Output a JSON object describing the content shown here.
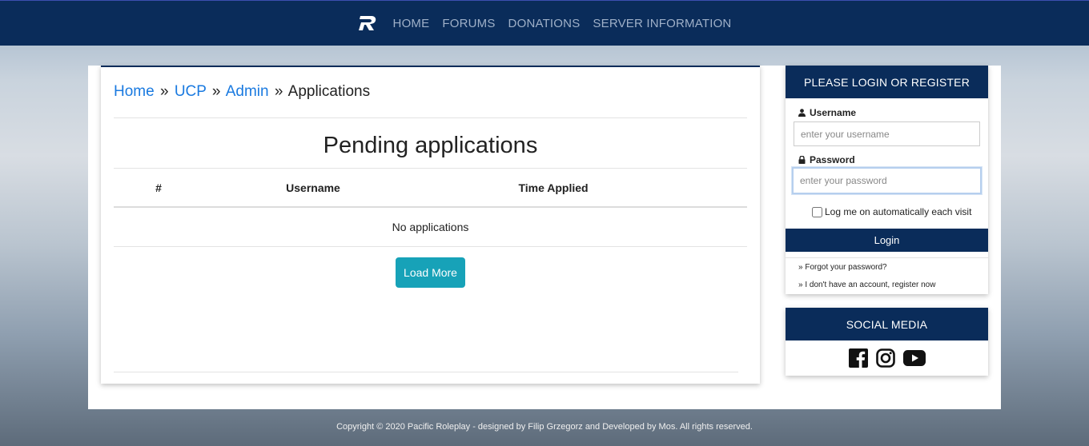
{
  "nav": {
    "links": [
      "HOME",
      "FORUMS",
      "DONATIONS",
      "SERVER INFORMATION"
    ]
  },
  "breadcrumb": {
    "home": "Home",
    "ucp": "UCP",
    "admin": "Admin",
    "current": "Applications",
    "separator": "»"
  },
  "main": {
    "title": "Pending applications",
    "columns": [
      "#",
      "Username",
      "Time Applied"
    ],
    "empty_message": "No applications",
    "load_more_label": "Load More"
  },
  "login": {
    "header": "PLEASE LOGIN OR REGISTER",
    "username_label": "Username",
    "username_placeholder": "enter your username",
    "password_label": "Password",
    "password_placeholder": "enter your password",
    "remember_label": "Log me on automatically each visit",
    "login_button": "Login",
    "forgot_link": "» Forgot your password?",
    "register_link": "» I don't have an account, register now"
  },
  "social": {
    "header": "SOCIAL MEDIA",
    "icons": [
      "facebook-icon",
      "instagram-icon",
      "youtube-icon"
    ]
  },
  "footer": {
    "text": "Copyright © 2020 Pacific Roleplay - designed by Filip Grzegorz and Developed by Mos. All rights reserved."
  },
  "colors": {
    "navy": "#0a2c5a",
    "link_blue": "#1a7ae0",
    "button_teal": "#17a2b8"
  }
}
